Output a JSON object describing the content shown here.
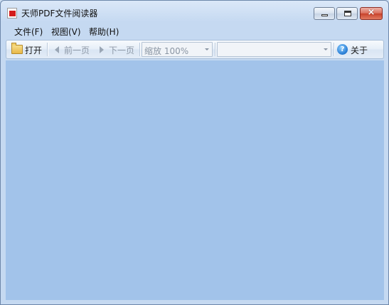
{
  "window": {
    "title": "天师PDF文件阅读器",
    "close_glyph": "×"
  },
  "menu": [
    {
      "label": "文件(F)"
    },
    {
      "label": "视图(V)"
    },
    {
      "label": "帮助(H)"
    }
  ],
  "toolbar": {
    "open_label": "打开",
    "prev_label": "前一页",
    "next_label": "下一页",
    "zoom_value": "缩放 100%",
    "page_value": "",
    "about_label": "关于",
    "help_glyph": "?"
  },
  "colors": {
    "content_bg": "#a2c3ea",
    "window_frame": "#c5d9f1",
    "close_button": "#c7412b"
  },
  "icons": [
    "pdf-app-icon",
    "folder-open-icon",
    "arrow-left-icon",
    "arrow-right-icon",
    "help-icon"
  ]
}
